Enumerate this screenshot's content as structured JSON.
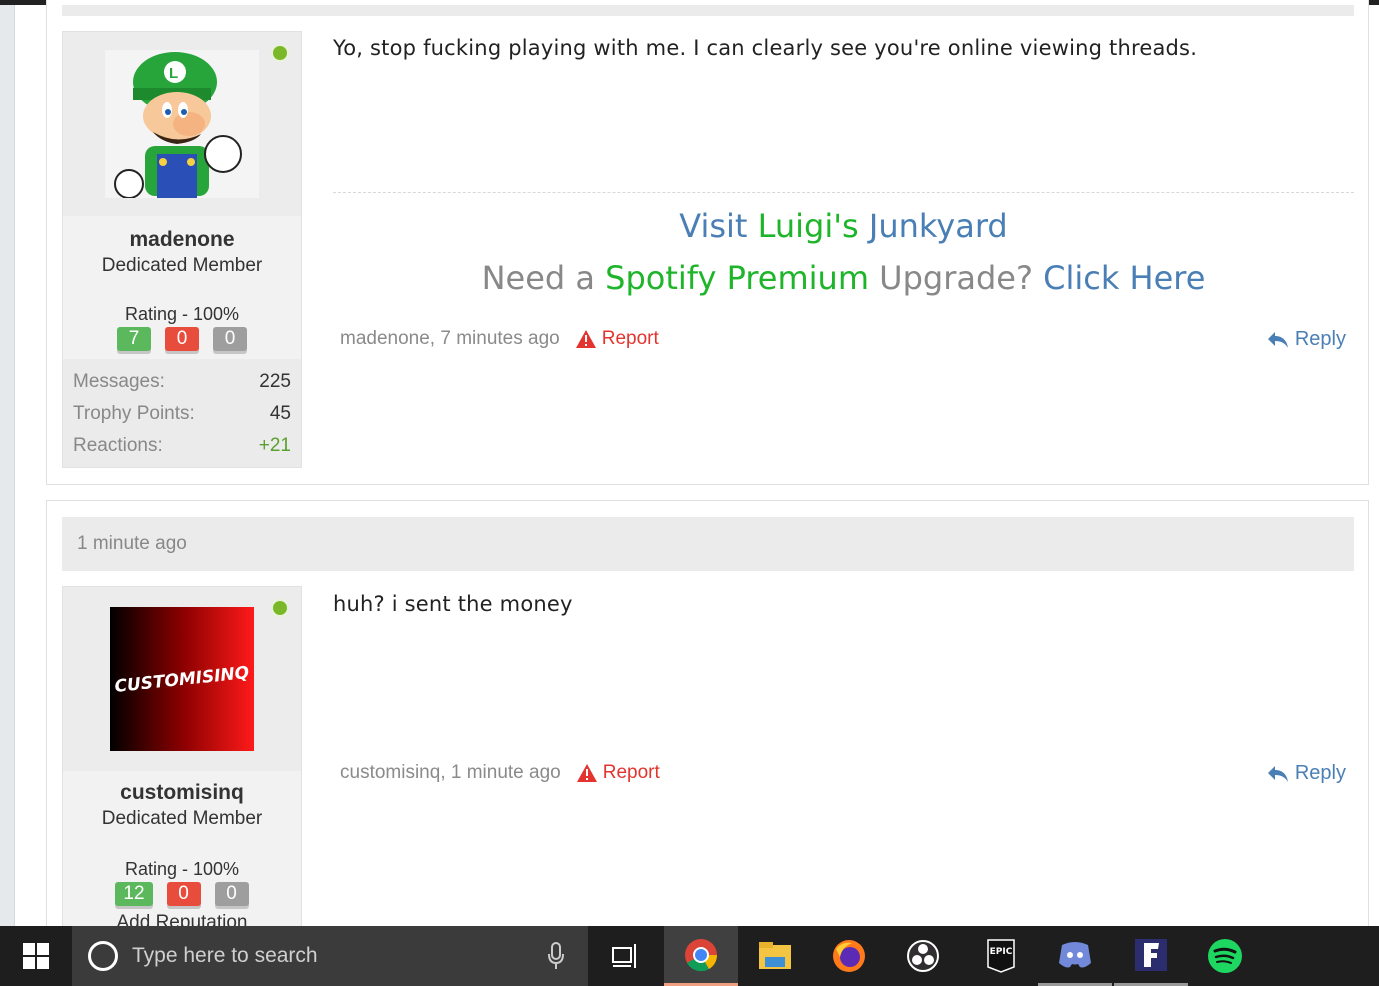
{
  "post1": {
    "username": "madenone",
    "user_title": "Dedicated Member",
    "rating": "Rating - 100%",
    "rep_positive": "7",
    "rep_negative": "0",
    "rep_neutral": "0",
    "stats": [
      {
        "label": "Messages:",
        "value": "225"
      },
      {
        "label": "Trophy Points:",
        "value": "45"
      },
      {
        "label": "Reactions:",
        "value": "+21"
      }
    ],
    "message": "Yo, stop fucking playing with me. I can clearly see you're online viewing threads.",
    "signature": {
      "line1_a": "Visit ",
      "line1_b": "Luigi's",
      "line1_c": " Junkyard",
      "line2_a": "Need a ",
      "line2_b": "Spotify Premium",
      "line2_c": " Upgrade? ",
      "line2_d": "Click Here"
    },
    "meta": "madenone, 7 minutes ago",
    "report": "Report",
    "reply": "Reply"
  },
  "post2": {
    "time_header": "1 minute ago",
    "username": "customisinq",
    "avatar_text": "CUSTOMISINQ",
    "user_title": "Dedicated Member",
    "rating": "Rating - 100%",
    "rep_positive": "12",
    "rep_negative": "0",
    "rep_neutral": "0",
    "add_reputation": "Add Reputation",
    "message": "huh? i sent the money",
    "meta": "customisinq, 1 minute ago",
    "report": "Report",
    "reply": "Reply"
  },
  "taskbar": {
    "search_placeholder": "Type here to search",
    "apps": [
      "task-view-icon",
      "chrome-icon",
      "file-explorer-icon",
      "firefox-icon",
      "obs-icon",
      "epic-games-icon",
      "discord-icon",
      "fortnite-icon",
      "spotify-icon"
    ],
    "epic_label": "EPIC"
  },
  "colors": {
    "link_blue": "#4a7fb5",
    "signature_green": "#1fb52a",
    "report_red": "#e3342f",
    "online_green": "#7ab82a"
  }
}
